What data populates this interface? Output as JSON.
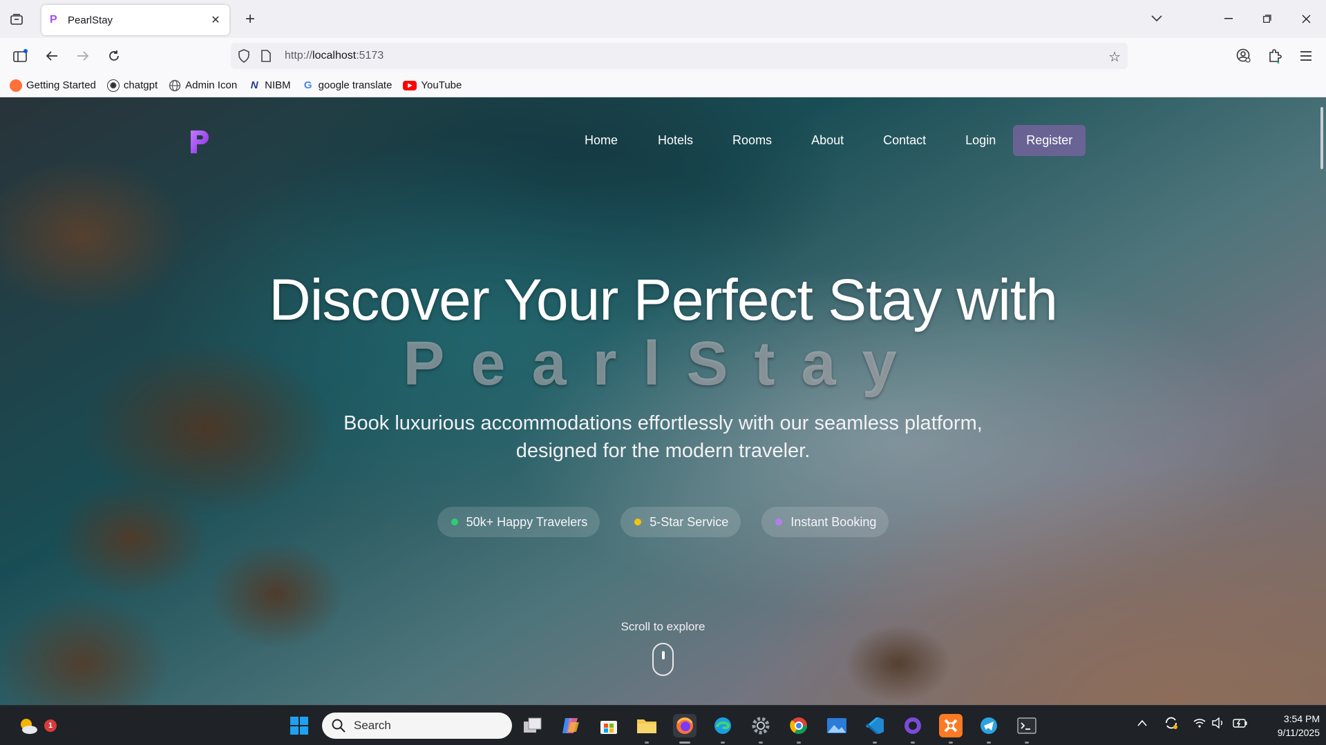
{
  "browser": {
    "tab_title": "PearlStay",
    "url_prefix": "http://",
    "url_host": "localhost",
    "url_port": ":5173",
    "bookmarks": [
      {
        "label": "Getting Started",
        "icon": "firefox-icon",
        "color": "#ff7139"
      },
      {
        "label": "chatgpt",
        "icon": "chatgpt-icon",
        "color": "#333333"
      },
      {
        "label": "Admin Icon",
        "icon": "globe-icon",
        "color": "#555555"
      },
      {
        "label": "NIBM",
        "icon": "nibm-icon",
        "color": "#1f3a93"
      },
      {
        "label": "google translate",
        "icon": "google-icon",
        "color": "#4285f4"
      },
      {
        "label": "YouTube",
        "icon": "youtube-icon",
        "color": "#ff0000"
      }
    ]
  },
  "site": {
    "nav": [
      "Home",
      "Hotels",
      "Rooms",
      "About",
      "Contact",
      "Login"
    ],
    "register": "Register",
    "logo_color": "#a24cf7"
  },
  "hero": {
    "title": "Discover Your Perfect Stay with",
    "brand": "PearlStay",
    "subtitle_line1": "Book luxurious accommodations effortlessly with our seamless platform,",
    "subtitle_line2": "designed for the modern traveler.",
    "pills": [
      {
        "label": "50k+ Happy Travelers",
        "dot": "#2ecc71"
      },
      {
        "label": "5-Star Service",
        "dot": "#f1c40f"
      },
      {
        "label": "Instant Booking",
        "dot": "#b57cf0"
      }
    ],
    "scroll_text": "Scroll to explore"
  },
  "taskbar": {
    "search_placeholder": "Search",
    "weather_badge": "1",
    "time": "3:54 PM",
    "date": "9/11/2025"
  }
}
